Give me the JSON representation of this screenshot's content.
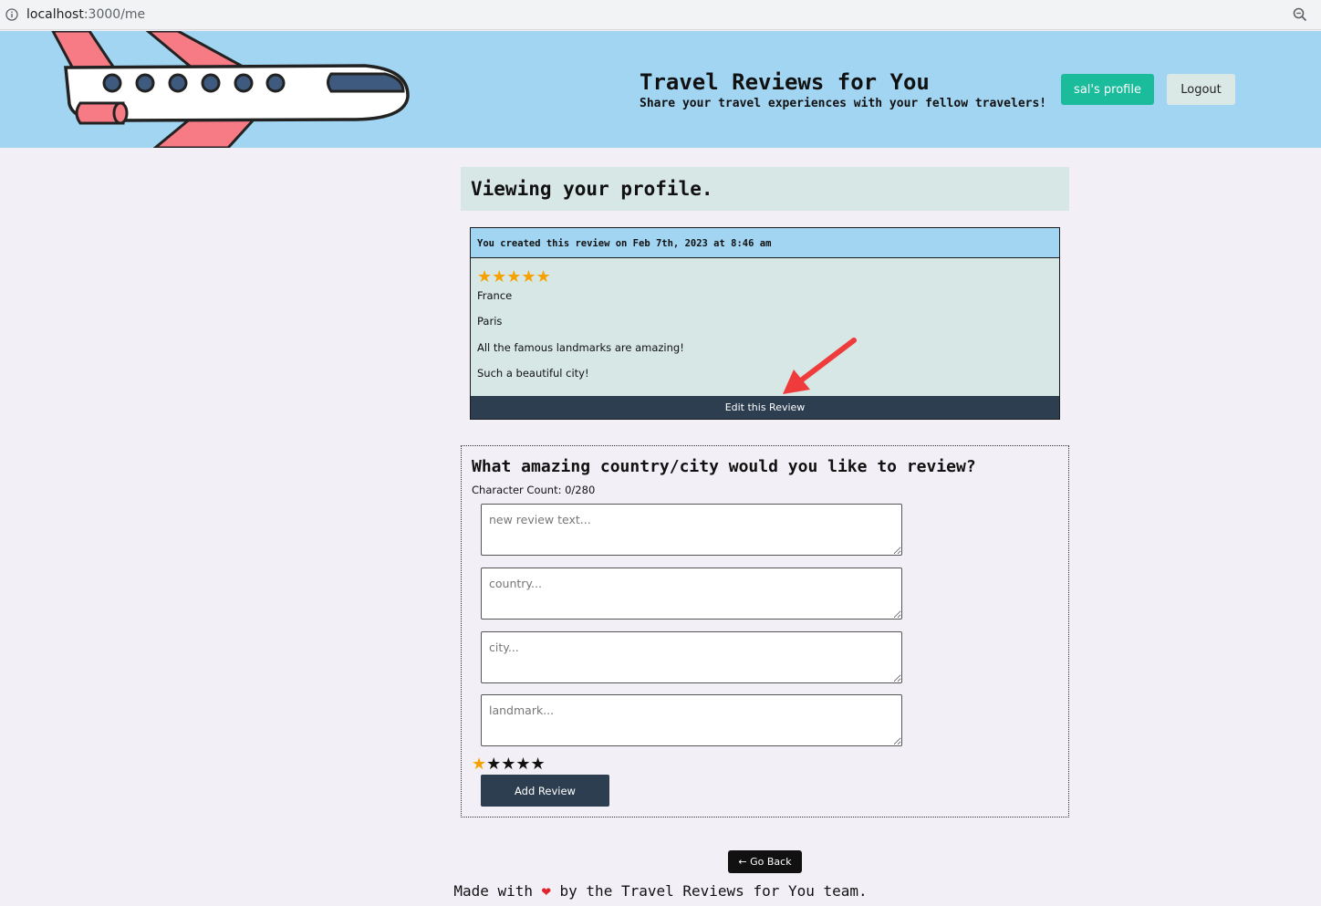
{
  "browser": {
    "url_host": "localhost",
    "url_path": ":3000/me"
  },
  "header": {
    "title": "Travel Reviews for You",
    "subtitle": "Share your travel experiences with your fellow travelers!",
    "profile_button": "sal's profile",
    "logout_button": "Logout",
    "colors": {
      "background": "#a2d5f2",
      "profile_button": "#1abc9c",
      "logout_button": "#dbe9e6"
    }
  },
  "profile": {
    "heading": "Viewing your profile."
  },
  "review": {
    "created_text": "You created this review on Feb 7th, 2023 at 8:46 am",
    "stars": "★★★★★",
    "rating": 5,
    "country": "France",
    "city": "Paris",
    "landmark": "All the famous landmarks are amazing!",
    "text": "Such a beautiful city!",
    "edit_button": "Edit this Review"
  },
  "form": {
    "heading": "What amazing country/city would you like to review?",
    "char_count": "Character Count: 0/280",
    "text_placeholder": "new review text...",
    "country_placeholder": "country...",
    "city_placeholder": "city...",
    "landmark_placeholder": "landmark...",
    "rating_on": "★",
    "rating_off": "★★★★",
    "rating": 1,
    "add_button": "Add Review"
  },
  "go_back_button": "← Go Back",
  "footer": {
    "before": "Made with ",
    "heart": "❤",
    "after": " by the Travel Reviews for You team."
  }
}
